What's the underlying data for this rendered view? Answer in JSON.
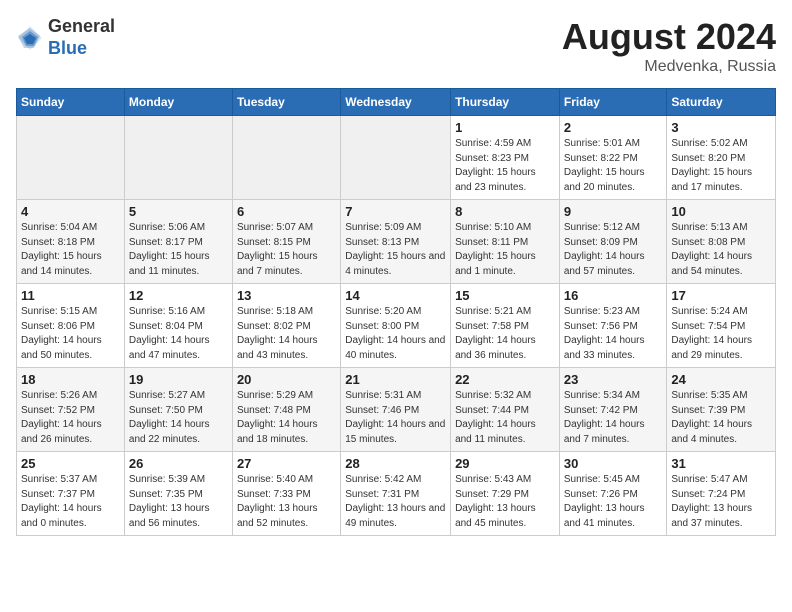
{
  "header": {
    "logo_general": "General",
    "logo_blue": "Blue",
    "title": "August 2024",
    "location": "Medvenka, Russia"
  },
  "calendar": {
    "day_headers": [
      "Sunday",
      "Monday",
      "Tuesday",
      "Wednesday",
      "Thursday",
      "Friday",
      "Saturday"
    ],
    "weeks": [
      [
        {
          "day": "",
          "detail": ""
        },
        {
          "day": "",
          "detail": ""
        },
        {
          "day": "",
          "detail": ""
        },
        {
          "day": "",
          "detail": ""
        },
        {
          "day": "1",
          "detail": "Sunrise: 4:59 AM\nSunset: 8:23 PM\nDaylight: 15 hours\nand 23 minutes."
        },
        {
          "day": "2",
          "detail": "Sunrise: 5:01 AM\nSunset: 8:22 PM\nDaylight: 15 hours\nand 20 minutes."
        },
        {
          "day": "3",
          "detail": "Sunrise: 5:02 AM\nSunset: 8:20 PM\nDaylight: 15 hours\nand 17 minutes."
        }
      ],
      [
        {
          "day": "4",
          "detail": "Sunrise: 5:04 AM\nSunset: 8:18 PM\nDaylight: 15 hours\nand 14 minutes."
        },
        {
          "day": "5",
          "detail": "Sunrise: 5:06 AM\nSunset: 8:17 PM\nDaylight: 15 hours\nand 11 minutes."
        },
        {
          "day": "6",
          "detail": "Sunrise: 5:07 AM\nSunset: 8:15 PM\nDaylight: 15 hours\nand 7 minutes."
        },
        {
          "day": "7",
          "detail": "Sunrise: 5:09 AM\nSunset: 8:13 PM\nDaylight: 15 hours\nand 4 minutes."
        },
        {
          "day": "8",
          "detail": "Sunrise: 5:10 AM\nSunset: 8:11 PM\nDaylight: 15 hours\nand 1 minute."
        },
        {
          "day": "9",
          "detail": "Sunrise: 5:12 AM\nSunset: 8:09 PM\nDaylight: 14 hours\nand 57 minutes."
        },
        {
          "day": "10",
          "detail": "Sunrise: 5:13 AM\nSunset: 8:08 PM\nDaylight: 14 hours\nand 54 minutes."
        }
      ],
      [
        {
          "day": "11",
          "detail": "Sunrise: 5:15 AM\nSunset: 8:06 PM\nDaylight: 14 hours\nand 50 minutes."
        },
        {
          "day": "12",
          "detail": "Sunrise: 5:16 AM\nSunset: 8:04 PM\nDaylight: 14 hours\nand 47 minutes."
        },
        {
          "day": "13",
          "detail": "Sunrise: 5:18 AM\nSunset: 8:02 PM\nDaylight: 14 hours\nand 43 minutes."
        },
        {
          "day": "14",
          "detail": "Sunrise: 5:20 AM\nSunset: 8:00 PM\nDaylight: 14 hours\nand 40 minutes."
        },
        {
          "day": "15",
          "detail": "Sunrise: 5:21 AM\nSunset: 7:58 PM\nDaylight: 14 hours\nand 36 minutes."
        },
        {
          "day": "16",
          "detail": "Sunrise: 5:23 AM\nSunset: 7:56 PM\nDaylight: 14 hours\nand 33 minutes."
        },
        {
          "day": "17",
          "detail": "Sunrise: 5:24 AM\nSunset: 7:54 PM\nDaylight: 14 hours\nand 29 minutes."
        }
      ],
      [
        {
          "day": "18",
          "detail": "Sunrise: 5:26 AM\nSunset: 7:52 PM\nDaylight: 14 hours\nand 26 minutes."
        },
        {
          "day": "19",
          "detail": "Sunrise: 5:27 AM\nSunset: 7:50 PM\nDaylight: 14 hours\nand 22 minutes."
        },
        {
          "day": "20",
          "detail": "Sunrise: 5:29 AM\nSunset: 7:48 PM\nDaylight: 14 hours\nand 18 minutes."
        },
        {
          "day": "21",
          "detail": "Sunrise: 5:31 AM\nSunset: 7:46 PM\nDaylight: 14 hours\nand 15 minutes."
        },
        {
          "day": "22",
          "detail": "Sunrise: 5:32 AM\nSunset: 7:44 PM\nDaylight: 14 hours\nand 11 minutes."
        },
        {
          "day": "23",
          "detail": "Sunrise: 5:34 AM\nSunset: 7:42 PM\nDaylight: 14 hours\nand 7 minutes."
        },
        {
          "day": "24",
          "detail": "Sunrise: 5:35 AM\nSunset: 7:39 PM\nDaylight: 14 hours\nand 4 minutes."
        }
      ],
      [
        {
          "day": "25",
          "detail": "Sunrise: 5:37 AM\nSunset: 7:37 PM\nDaylight: 14 hours\nand 0 minutes."
        },
        {
          "day": "26",
          "detail": "Sunrise: 5:39 AM\nSunset: 7:35 PM\nDaylight: 13 hours\nand 56 minutes."
        },
        {
          "day": "27",
          "detail": "Sunrise: 5:40 AM\nSunset: 7:33 PM\nDaylight: 13 hours\nand 52 minutes."
        },
        {
          "day": "28",
          "detail": "Sunrise: 5:42 AM\nSunset: 7:31 PM\nDaylight: 13 hours\nand 49 minutes."
        },
        {
          "day": "29",
          "detail": "Sunrise: 5:43 AM\nSunset: 7:29 PM\nDaylight: 13 hours\nand 45 minutes."
        },
        {
          "day": "30",
          "detail": "Sunrise: 5:45 AM\nSunset: 7:26 PM\nDaylight: 13 hours\nand 41 minutes."
        },
        {
          "day": "31",
          "detail": "Sunrise: 5:47 AM\nSunset: 7:24 PM\nDaylight: 13 hours\nand 37 minutes."
        }
      ]
    ]
  }
}
